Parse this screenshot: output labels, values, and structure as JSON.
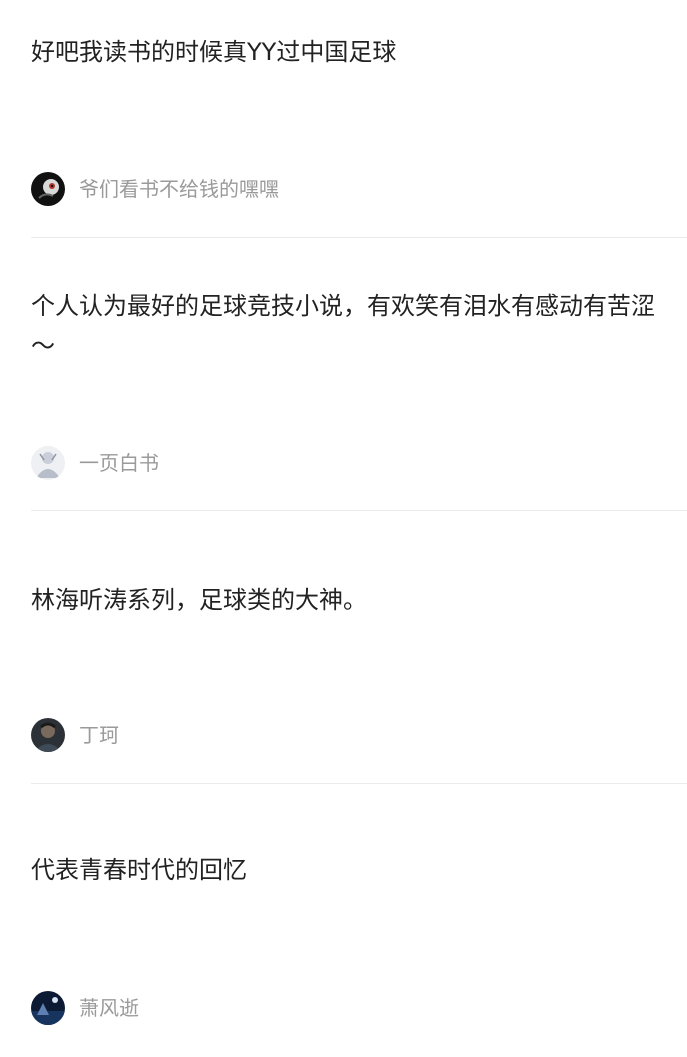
{
  "answers": [
    {
      "text": "好吧我读书的时候真YY过中国足球",
      "author": "爷们看书不给钱的嘿嘿",
      "avatar_icon": "user-avatar-dark-bird"
    },
    {
      "text": "个人认为最好的足球竞技小说，有欢笑有泪水有感动有苦涩～",
      "author": "一页白书",
      "avatar_icon": "user-avatar-light-figure"
    },
    {
      "text": "林海听涛系列，足球类的大神。",
      "author": "丁珂",
      "avatar_icon": "user-avatar-portrait"
    },
    {
      "text": "代表青春时代的回忆",
      "author": "萧风逝",
      "avatar_icon": "user-avatar-night-scene"
    }
  ]
}
